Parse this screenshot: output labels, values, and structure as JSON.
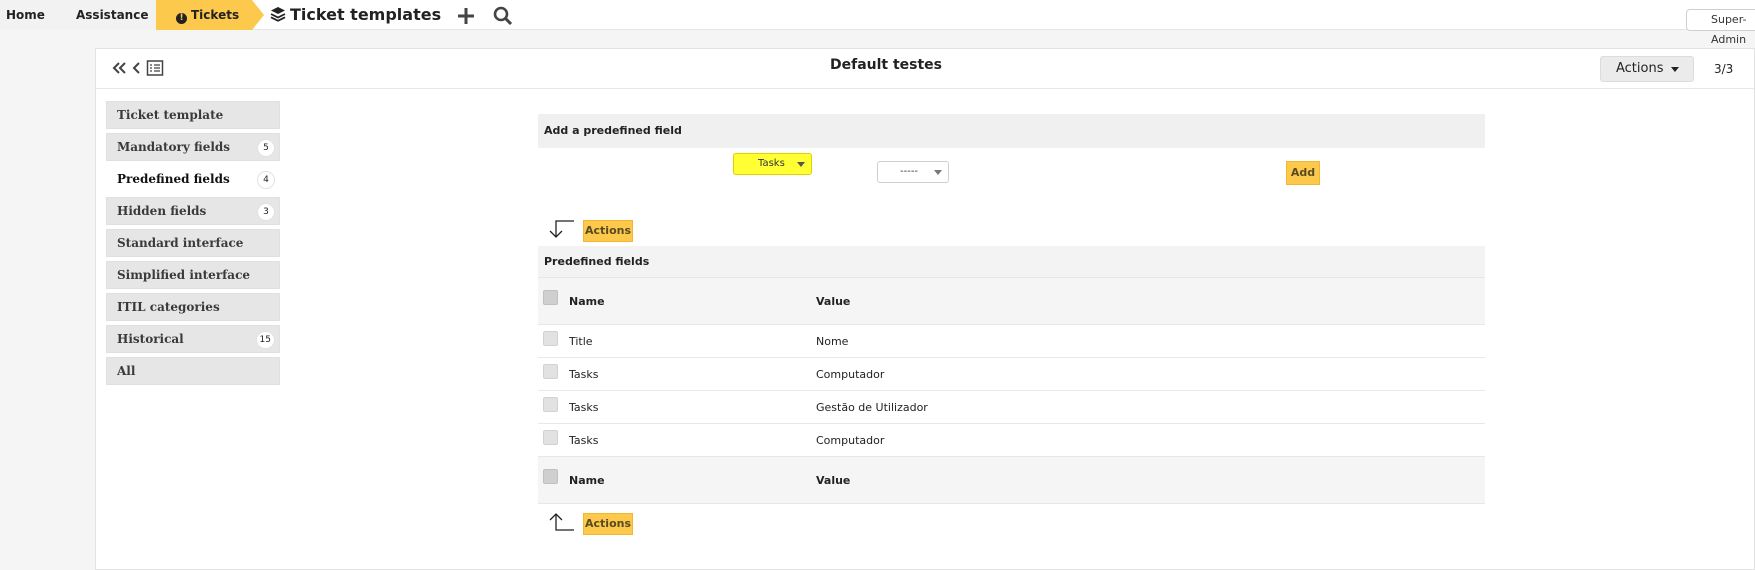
{
  "topbar": {
    "breadcrumbs": [
      "Home",
      "Assistance",
      "Tickets"
    ],
    "page_title": "Ticket templates",
    "user_name": "Super-Admin"
  },
  "record": {
    "title": "Default testes",
    "actions_label": "Actions",
    "pager": "3/3"
  },
  "tabs": [
    {
      "label": "Ticket template",
      "badge": ""
    },
    {
      "label": "Mandatory fields",
      "badge": "5"
    },
    {
      "label": "Predefined fields",
      "badge": "4"
    },
    {
      "label": "Hidden fields",
      "badge": "3"
    },
    {
      "label": "Standard interface",
      "badge": ""
    },
    {
      "label": "Simplified interface",
      "badge": ""
    },
    {
      "label": "ITIL categories",
      "badge": ""
    },
    {
      "label": "Historical",
      "badge": "15"
    },
    {
      "label": "All",
      "badge": ""
    }
  ],
  "add_section": {
    "title": "Add a predefined field",
    "field_select_value": "Tasks",
    "value_select_value": "-----",
    "add_label": "Add"
  },
  "mass_actions": {
    "label": "Actions"
  },
  "table": {
    "caption": "Predefined fields",
    "columns": [
      "Name",
      "Value"
    ],
    "rows": [
      {
        "name": "Title",
        "value": "Nome"
      },
      {
        "name": "Tasks",
        "value": "Computador"
      },
      {
        "name": "Tasks",
        "value": "Gestão de Utilizador"
      },
      {
        "name": "Tasks",
        "value": "Computador"
      }
    ]
  },
  "colors": {
    "accent": "#fcc94c",
    "highlight": "#ffff33"
  }
}
